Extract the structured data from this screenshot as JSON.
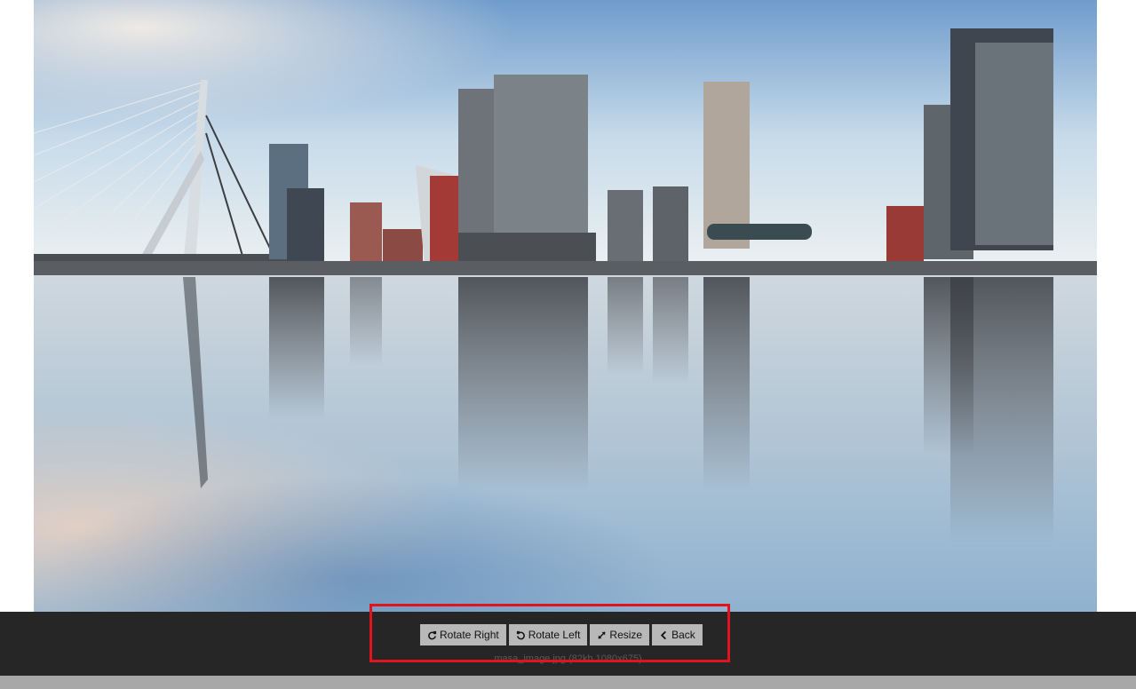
{
  "image": {
    "alt": "rotterdam skyline reflection",
    "subject": "City skyline with cable-stayed bridge and high-rise towers reflected in calm water"
  },
  "toolbar": {
    "buttons": [
      {
        "label": "Rotate Right",
        "icon": "rotate-right-icon"
      },
      {
        "label": "Rotate Left",
        "icon": "rotate-left-icon"
      },
      {
        "label": "Resize",
        "icon": "resize-icon"
      },
      {
        "label": "Back",
        "icon": "chevron-left-icon"
      }
    ],
    "caption": "masa_image.jpg (82kb 1080x675)"
  },
  "colors": {
    "toolbar_bg": "#262626",
    "button_bg": "#b8b8b8",
    "highlight": "#e0141e"
  }
}
